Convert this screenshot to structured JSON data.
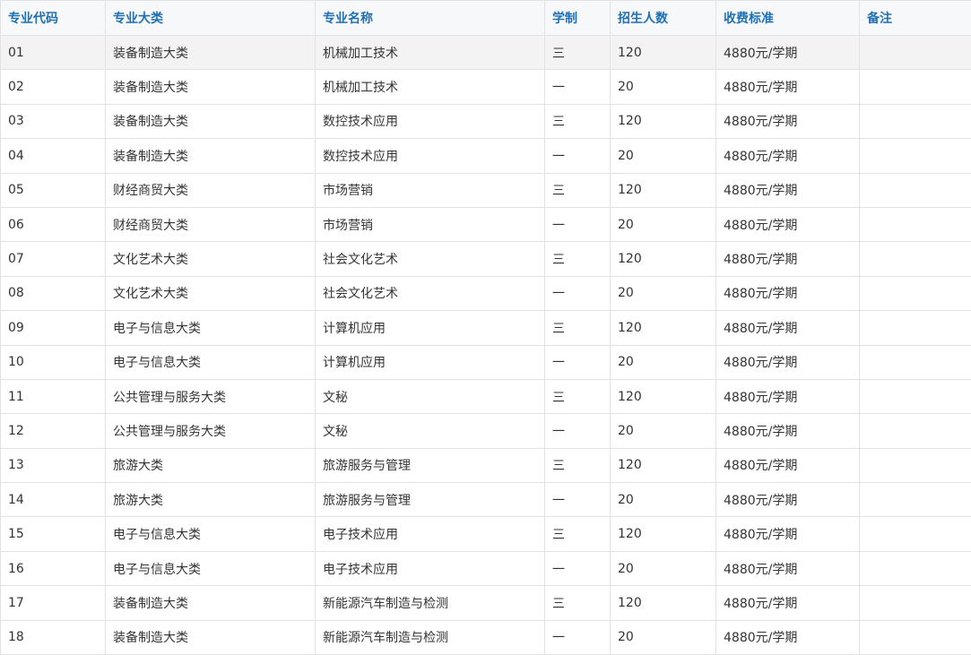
{
  "table": {
    "headers": [
      "专业代码",
      "专业大类",
      "专业名称",
      "学制",
      "招生人数",
      "收费标准",
      "备注"
    ],
    "rows": [
      [
        "01",
        "装备制造大类",
        "机械加工技术",
        "三",
        "120",
        "4880元/学期",
        ""
      ],
      [
        "02",
        "装备制造大类",
        "机械加工技术",
        "一",
        "20",
        "4880元/学期",
        ""
      ],
      [
        "03",
        "装备制造大类",
        "数控技术应用",
        "三",
        "120",
        "4880元/学期",
        ""
      ],
      [
        "04",
        "装备制造大类",
        "数控技术应用",
        "一",
        "20",
        "4880元/学期",
        ""
      ],
      [
        "05",
        "财经商贸大类",
        "市场营销",
        "三",
        "120",
        "4880元/学期",
        ""
      ],
      [
        "06",
        "财经商贸大类",
        "市场营销",
        "一",
        "20",
        "4880元/学期",
        ""
      ],
      [
        "07",
        "文化艺术大类",
        "社会文化艺术",
        "三",
        "120",
        "4880元/学期",
        ""
      ],
      [
        "08",
        "文化艺术大类",
        "社会文化艺术",
        "一",
        "20",
        "4880元/学期",
        ""
      ],
      [
        "09",
        "电子与信息大类",
        "计算机应用",
        "三",
        "120",
        "4880元/学期",
        ""
      ],
      [
        "10",
        "电子与信息大类",
        "计算机应用",
        "一",
        "20",
        "4880元/学期",
        ""
      ],
      [
        "11",
        "公共管理与服务大类",
        "文秘",
        "三",
        "120",
        "4880元/学期",
        ""
      ],
      [
        "12",
        "公共管理与服务大类",
        "文秘",
        "一",
        "20",
        "4880元/学期",
        ""
      ],
      [
        "13",
        "旅游大类",
        "旅游服务与管理",
        "三",
        "120",
        "4880元/学期",
        ""
      ],
      [
        "14",
        "旅游大类",
        "旅游服务与管理",
        "一",
        "20",
        "4880元/学期",
        ""
      ],
      [
        "15",
        "电子与信息大类",
        "电子技术应用",
        "三",
        "120",
        "4880元/学期",
        ""
      ],
      [
        "16",
        "电子与信息大类",
        "电子技术应用",
        "一",
        "20",
        "4880元/学期",
        ""
      ],
      [
        "17",
        "装备制造大类",
        "新能源汽车制造与检测",
        "三",
        "120",
        "4880元/学期",
        ""
      ],
      [
        "18",
        "装备制造大类",
        "新能源汽车制造与检测",
        "一",
        "20",
        "4880元/学期",
        ""
      ]
    ]
  },
  "colors": {
    "header_text": "#1f6fb5",
    "body_text": "#333333",
    "border": "#e2e2e2",
    "header_bg": "#f7f8fa",
    "highlight_row_bg": "#f3f3f3"
  }
}
